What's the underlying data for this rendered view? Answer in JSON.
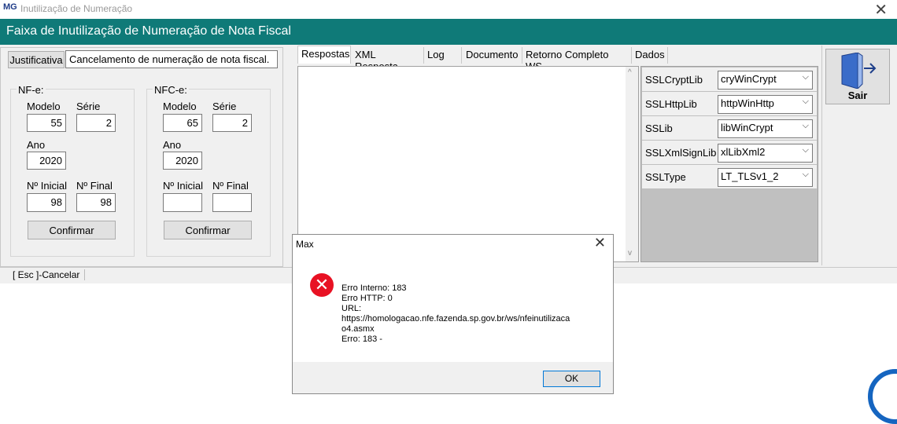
{
  "window": {
    "title": "Inutilização de Numeração",
    "header": "Faixa de Inutilização de Numeração de Nota Fiscal",
    "app_icon_text": "MG"
  },
  "justificativa": {
    "label": "Justificativa",
    "value": "Cancelamento de numeração de nota fiscal."
  },
  "nfe": {
    "legend": "NF-e:",
    "modelo_label": "Modelo",
    "modelo": "55",
    "serie_label": "Série",
    "serie": "2",
    "ano_label": "Ano",
    "ano": "2020",
    "inicial_label": "Nº Inicial",
    "inicial": "98",
    "final_label": "Nº Final",
    "final": "98",
    "confirm": "Confirmar"
  },
  "nfce": {
    "legend": "NFC-e:",
    "modelo_label": "Modelo",
    "modelo": "65",
    "serie_label": "Série",
    "serie": "2",
    "ano_label": "Ano",
    "ano": "2020",
    "inicial_label": "Nº Inicial",
    "inicial": "",
    "final_label": "Nº Final",
    "final": "",
    "confirm": "Confirmar"
  },
  "tabs": [
    "Respostas",
    "XML Resposta",
    "Log",
    "Documento",
    "Retorno Completo WS",
    "Dados"
  ],
  "props": [
    {
      "label": "SSLCryptLib",
      "value": "cryWinCrypt"
    },
    {
      "label": "SSLHttpLib",
      "value": "httpWinHttp"
    },
    {
      "label": "SSLib",
      "value": "libWinCrypt"
    },
    {
      "label": "SSLXmlSignLib",
      "value": "xlLibXml2"
    },
    {
      "label": "SSLType",
      "value": "LT_TLSv1_2"
    }
  ],
  "sair": "Sair",
  "status": "[ Esc ]-Cancelar",
  "dialog": {
    "title": "Max",
    "lines": [
      "Erro Interno: 183",
      "Erro HTTP: 0",
      "URL:",
      "https://homologacao.nfe.fazenda.sp.gov.br/ws/nfeinutilizaca",
      "o4.asmx",
      "Erro: 183 -"
    ],
    "ok": "OK"
  }
}
